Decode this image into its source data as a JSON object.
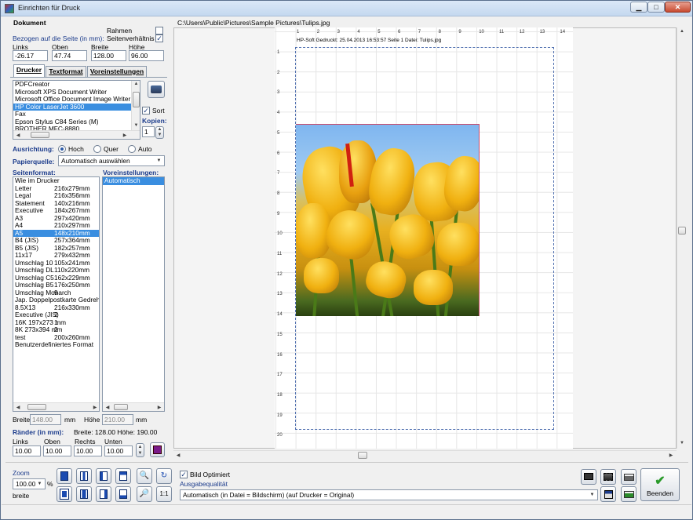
{
  "window": {
    "title": "Einrichten für Druck",
    "min": "▁",
    "max": "□",
    "close": "✕"
  },
  "dokument": {
    "heading": "Dokument",
    "bezogen": "Bezogen auf die Seite (in mm):",
    "rahmen": "Rahmen",
    "seitenverhaeltnis": "Seitenverhältnis",
    "rahmen_checked": false,
    "seitenverhaeltnis_checked": true,
    "fields": [
      {
        "label": "Links",
        "value": "-26.17"
      },
      {
        "label": "Oben",
        "value": "47.74"
      },
      {
        "label": "Breite",
        "value": "128.00"
      },
      {
        "label": "Höhe",
        "value": "96.00"
      }
    ]
  },
  "tabs": [
    "Drucker",
    "Textformat",
    "Voreinstellungen"
  ],
  "printers": {
    "items": [
      "PDFCreator",
      "Microsoft XPS Document Writer",
      "Microsoft Office Document Image Writer",
      "HP Color LaserJet 3600",
      "Fax",
      "Epson Stylus C84 Series (M)",
      "BROTHER MFC-8880"
    ],
    "selected": "HP Color LaserJet 3600",
    "sort_label": "Sort",
    "sort_checked": true,
    "kopien_label": "Kopien:",
    "kopien_value": "1"
  },
  "ausrichtung": {
    "label": "Ausrichtung:",
    "options": [
      "Hoch",
      "Quer",
      "Auto"
    ],
    "selected": "Hoch"
  },
  "papierquelle": {
    "label": "Papierquelle:",
    "value": "Automatisch auswählen"
  },
  "seitenformat": {
    "label": "Seitenformat:",
    "items": [
      [
        "Wie im Drucker",
        ""
      ],
      [
        "Letter",
        "216x279mm"
      ],
      [
        "Legal",
        "216x356mm"
      ],
      [
        "Statement",
        "140x216mm"
      ],
      [
        "Executive",
        "184x267mm"
      ],
      [
        "A3",
        "297x420mm"
      ],
      [
        "A4",
        "210x297mm"
      ],
      [
        "A5",
        "148x210mm"
      ],
      [
        "B4 (JIS)",
        "257x364mm"
      ],
      [
        "B5 (JIS)",
        "182x257mm"
      ],
      [
        "11x17",
        "279x432mm"
      ],
      [
        "Umschlag 10",
        "105x241mm"
      ],
      [
        "Umschlag DL",
        "110x220mm"
      ],
      [
        "Umschlag C5",
        "162x229mm"
      ],
      [
        "Umschlag B5",
        "176x250mm"
      ],
      [
        "Umschlag Monarch",
        "9"
      ],
      [
        "Jap. Doppelpostkarte Gedreht",
        ""
      ],
      [
        "8.5X13",
        "216x330mm"
      ],
      [
        "Executive (JIS)",
        "2"
      ],
      [
        "16K 197x273 mm",
        "1"
      ],
      [
        "8K 273x394 mm",
        "2"
      ],
      [
        "test",
        "200x260mm"
      ],
      [
        "Benutzerdefiniertes Format",
        ""
      ]
    ],
    "selected_index": 7
  },
  "voreinstellungen": {
    "label": "Voreinstellungen:",
    "items": [
      "Automatisch"
    ],
    "selected_index": 0
  },
  "groesse": {
    "breite_label": "Breite",
    "breite_value": "148.00",
    "hoehe_label": "Höhe",
    "hoehe_value": "210.00",
    "unit": "mm"
  },
  "raender": {
    "label": "Ränder (in mm):",
    "info": "Breite: 128.00  Höhe: 190.00",
    "fields": [
      {
        "label": "Links",
        "value": "10.00"
      },
      {
        "label": "Oben",
        "value": "10.00"
      },
      {
        "label": "Rechts",
        "value": "10.00"
      },
      {
        "label": "Unten",
        "value": "10.00"
      }
    ]
  },
  "preview": {
    "path": "C:\\Users\\Public\\Pictures\\Sample Pictures\\Tulips.jpg",
    "header": "HP-Soft    Gedruckt: 25.04.2013 16:53:57    Seite 1    Datei: Tulips.jpg",
    "ruler_top": [
      "1",
      "2",
      "3",
      "4",
      "5",
      "6",
      "7",
      "8",
      "9",
      "10",
      "11",
      "12",
      "13",
      "14"
    ],
    "ruler_left": [
      "1",
      "2",
      "3",
      "4",
      "5",
      "6",
      "7",
      "8",
      "9",
      "10",
      "11",
      "12",
      "13",
      "14",
      "15",
      "16",
      "17",
      "18",
      "19",
      "20"
    ]
  },
  "zoom": {
    "label": "Zoom",
    "value": "100.00",
    "unit": "%",
    "breite": "breite",
    "one_to_one": "1:1"
  },
  "bild_optimiert": {
    "label": "Bild Optimiert",
    "checked": true
  },
  "ausgabequalitaet": {
    "label": "Ausgabequalität",
    "value": "Automatisch (in Datei = Bildschirm) (auf Drucker = Original)"
  },
  "beenden": {
    "label": "Beenden",
    "icon": "check-icon"
  },
  "colors": {
    "accent": "#1c3c8c",
    "selection": "#3a8ee0",
    "ok_green": "#2a9a2a"
  }
}
